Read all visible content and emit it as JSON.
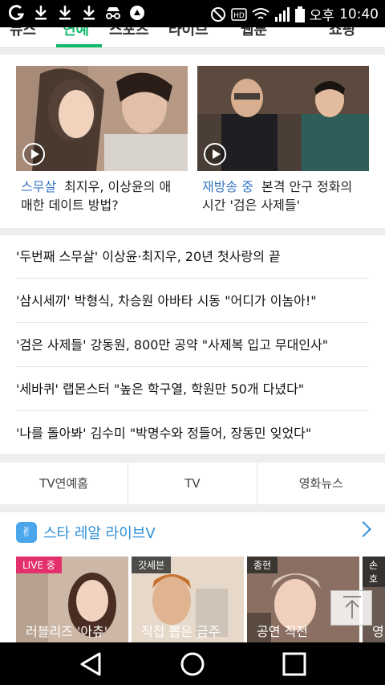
{
  "status_bar": {
    "carrier": "오후",
    "time": "10:40",
    "icons": [
      "app-g-icon",
      "download-icon",
      "download-icon",
      "download-icon",
      "incognito-icon",
      "notification-icon",
      "mute-icon",
      "hd-icon",
      "wifi-icon",
      "signal-icon",
      "battery-icon"
    ]
  },
  "tabs": [
    {
      "label": "뉴스"
    },
    {
      "label": "연예",
      "active": true
    },
    {
      "label": "스포츠"
    },
    {
      "label": "라이브"
    },
    {
      "label": "웹툰"
    },
    {
      "label": "쇼핑"
    }
  ],
  "featured": [
    {
      "tag": "스무살",
      "text": "최지우, 이상윤의 애매한 데이트 방법?",
      "line1": "최지우, 이상윤의 애",
      "line2": "매한 데이트 방법?"
    },
    {
      "tag": "재방송 중",
      "text": "본격 안구 정화의 시간 '검은 사제들'",
      "line1": "본격 안구 정화의",
      "line2": "시간 '검은 사제들'"
    }
  ],
  "headlines": [
    "'두번째 스무살' 이상윤·최지우, 20년 첫사랑의 끝",
    "'삼시세끼' 박형식, 차승원 아바타 시동 \"어디가 이놈아!\"",
    "'검은 사제들' 강동원, 800만 공약 \"사제복 입고 무대인사\"",
    "'세바퀴' 랩몬스터 \"높은 학구열, 학원만 50개 다녔다\"",
    "'나를 돌아봐' 김수미 \"박명수와 정들어, 장동민 잊었다\""
  ],
  "subnav": [
    "TV연예홈",
    "TV",
    "영화뉴스"
  ],
  "live": {
    "title": "스타 레알 라이브V",
    "items": [
      {
        "badge": "LIVE 중",
        "caption": "러블리즈 '아츄'"
      },
      {
        "badge": "갓세븐",
        "caption": "직접 뽑은 금주"
      },
      {
        "badge": "종현",
        "caption": "공연 직전"
      },
      {
        "badge": "손호",
        "caption": "영"
      }
    ]
  },
  "colors": {
    "accent": "#13b96b",
    "tag_blue": "#3b78c4",
    "live_blue": "#2e8fd8",
    "live_badge": "#e3306c"
  }
}
